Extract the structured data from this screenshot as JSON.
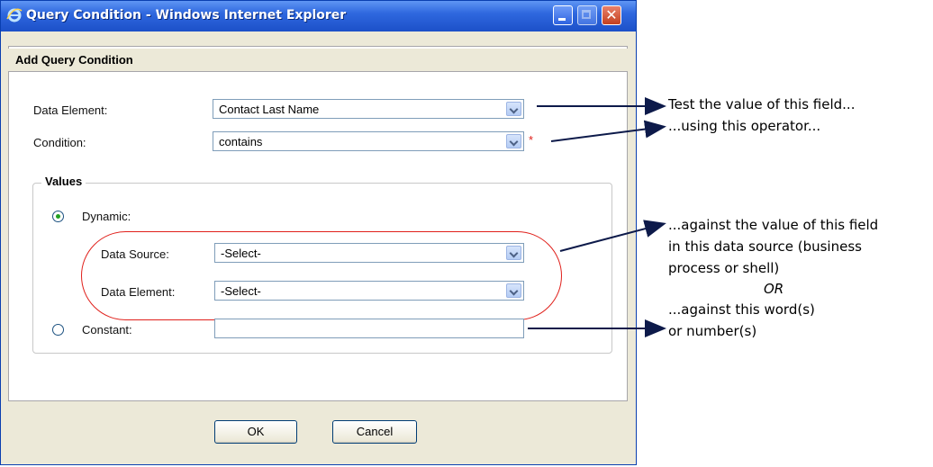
{
  "window": {
    "title": "Query Condition - Windows Internet Explorer"
  },
  "dialog": {
    "header": "Add Query Condition",
    "data_element": {
      "label": "Data Element:",
      "value": "Contact Last Name"
    },
    "condition": {
      "label": "Condition:",
      "value": "contains",
      "required_marker": "*"
    },
    "values_group": {
      "legend": "Values",
      "dynamic": {
        "label": "Dynamic:",
        "selected": true
      },
      "data_source": {
        "label": "Data Source:",
        "value": "-Select-"
      },
      "data_element": {
        "label": "Data Element:",
        "value": "-Select-"
      },
      "constant": {
        "label": "Constant:",
        "selected": false,
        "value": ""
      }
    },
    "ok_label": "OK",
    "cancel_label": "Cancel"
  },
  "annotations": {
    "note1_line1": "Test the value of this field...",
    "note1_line2": "...using this operator...",
    "note2_line1": "...against the value of this field",
    "note2_line2": "in this data source (business",
    "note2_line3": "process or shell)",
    "or_text": "OR",
    "note3_line1": "...against this word(s)",
    "note3_line2": "or number(s)"
  },
  "colors": {
    "title_bar": "#2f68df",
    "oval": "#e0201b",
    "required": "#e0201b",
    "arrow": "#0d1a4a"
  }
}
